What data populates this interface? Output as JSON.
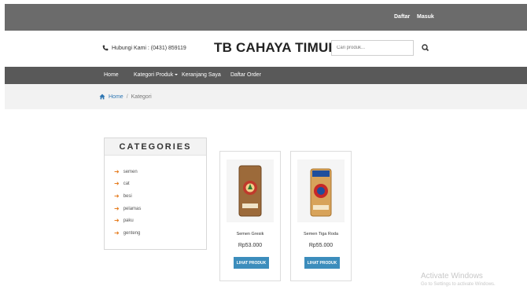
{
  "topbar": {
    "daftar": "Daftar",
    "masuk": "Masuk"
  },
  "header": {
    "phone": "Hubungi Kami : (0431) 859119",
    "brand": "TB CAHAYA TIMUR",
    "search_placeholder": "Cari produk..."
  },
  "nav": {
    "home": "Home",
    "kategori": "Kategori Produk",
    "keranjang": "Keranjang Saya",
    "order": "Daftar Order"
  },
  "breadcrumb": {
    "home": "Home",
    "separator": "/",
    "current": "Kategori"
  },
  "categories": {
    "title": "CATEGORIES",
    "items": [
      "semen",
      "cat",
      "besi",
      "pelamas",
      "paku",
      "genteng"
    ]
  },
  "products": [
    {
      "name": "Semen Gresik",
      "price": "Rp53.000",
      "button": "LIHAT PRODUK"
    },
    {
      "name": "Semen Tiga Roda",
      "price": "Rp55.000",
      "button": "LIHAT PRODUK"
    }
  ],
  "watermark": {
    "title": "Activate Windows",
    "subtitle": "Go to Settings to activate Windows."
  },
  "colors": {
    "topbar": "#6b6b6b",
    "navbar": "#595959",
    "link": "#2f77b3",
    "button": "#3c8dbc",
    "arrow": "#e67e22"
  }
}
